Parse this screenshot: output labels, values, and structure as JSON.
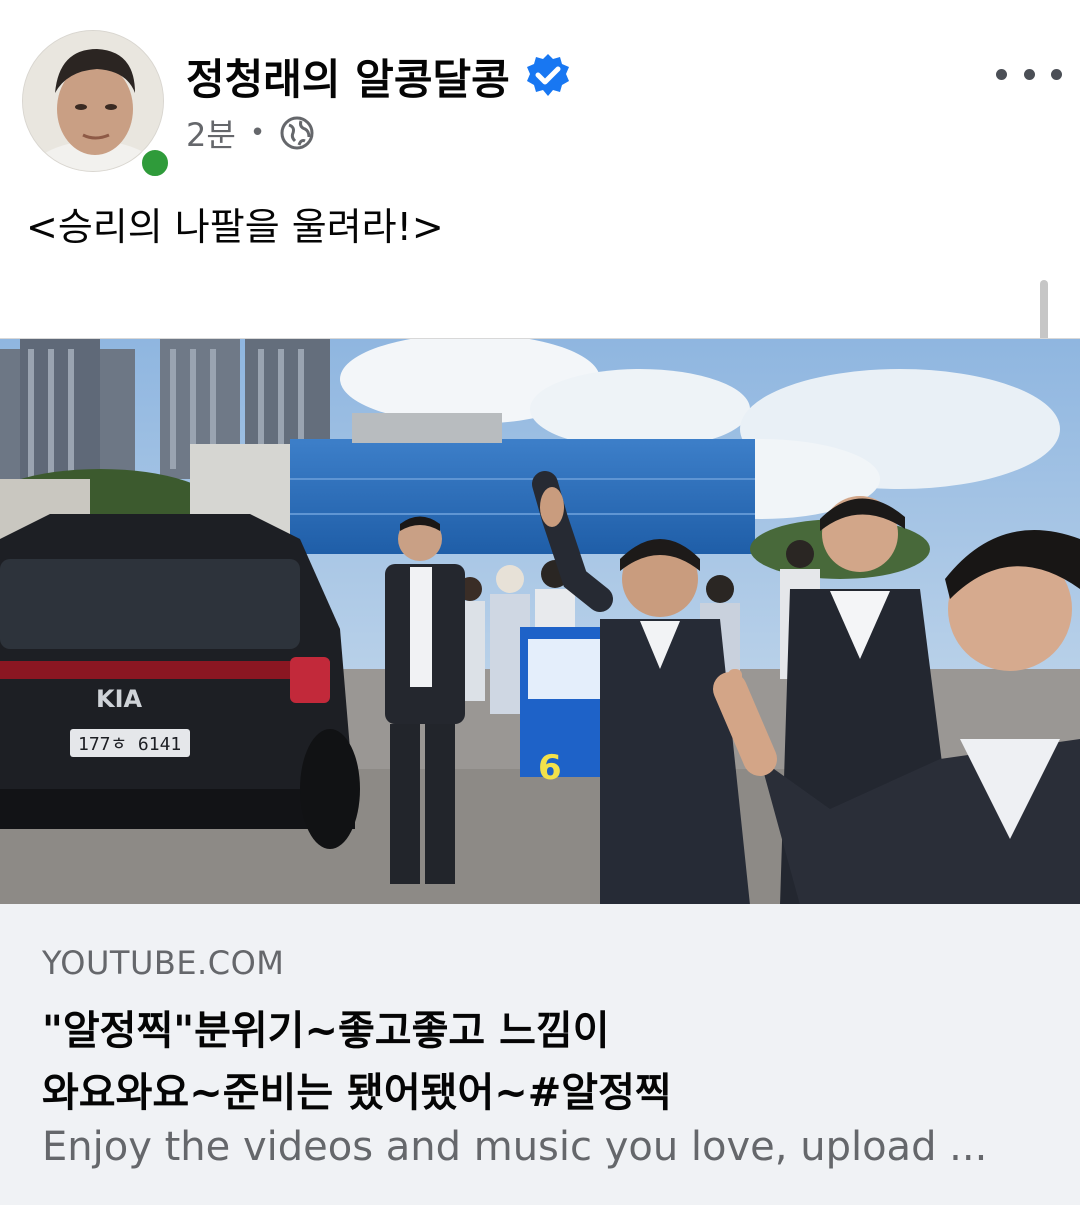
{
  "post": {
    "author_name": "정청래의 알콩달콩",
    "time": "2분",
    "separator": "•",
    "text": "<승리의 나팔을 울려라!>"
  },
  "icons": {
    "verified": "verified-badge-icon",
    "audience": "globe-icon",
    "more": "more-options-icon"
  },
  "colors": {
    "verified_blue": "#1877f2",
    "online_green": "#2f9b3a",
    "link_card_bg": "#f0f2f5",
    "secondary_text": "#65676b"
  },
  "link_preview": {
    "domain": "YOUTUBE.COM",
    "title_line1": "\"알정찍\"분위기~좋고좋고 느낌이",
    "title_line2": "와요와요~준비는 됐어됐어~#알정찍",
    "description": "Enjoy the videos and music you love, upload ..."
  },
  "image": {
    "sign_text": "6",
    "plate_text": "177ㅎ 6141",
    "car_brand": "KIA"
  }
}
